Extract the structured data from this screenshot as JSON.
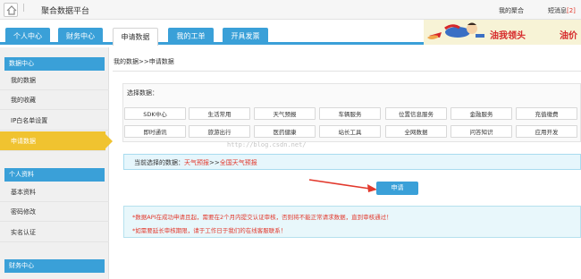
{
  "app": {
    "title": "聚合数据平台"
  },
  "topbar": {
    "my_account": "我的聚合",
    "messages_label": "短消息",
    "messages_count": "[2]"
  },
  "nav": {
    "tabs": [
      {
        "label": "个人中心"
      },
      {
        "label": "财务中心"
      },
      {
        "label": "申请数据"
      },
      {
        "label": "我的工单"
      },
      {
        "label": "开具发票"
      }
    ],
    "active": "申请数据"
  },
  "banner": {
    "text1": "油我领头",
    "text2": "油价"
  },
  "sidebar": {
    "sections": [
      {
        "title": "数据中心",
        "items": [
          "我的数据",
          "我的收藏",
          "IP白名单设置",
          "申请数据"
        ]
      },
      {
        "title": "个人资料",
        "items": [
          "基本资料",
          "密码修改",
          "实名认证"
        ]
      },
      {
        "title": "财务中心",
        "items": []
      }
    ],
    "active_item": "申请数据"
  },
  "breadcrumb": "我的数据>>申请数据",
  "select": {
    "label": "选择数据：",
    "row1": [
      "SDK中心",
      "生活常用",
      "天气预报",
      "车辆服务",
      "位置信息服务",
      "金融服务",
      "充值缴费"
    ],
    "row2": [
      "即时通讯",
      "旅游出行",
      "医药健康",
      "站长工具",
      "全网数据",
      "问答知识",
      "应用开发"
    ]
  },
  "current": {
    "prefix": "当前选择的数据：",
    "category": "天气预报",
    "sep": ">>",
    "item": "全国天气预报"
  },
  "apply_button": "申请",
  "notices": [
    "*数据API在成功申请且起，需要在2个月内提交认证审核，否则将不能正常请求数据，直到审核通过！",
    "*如需要延长审核期限，请于工作日于我们的在线客服联系！"
  ],
  "watermark": "http://blog.csdn.net/",
  "colors": {
    "accent": "#3aa0d8",
    "active_side": "#f0c330",
    "highlight": "#e2382c"
  }
}
